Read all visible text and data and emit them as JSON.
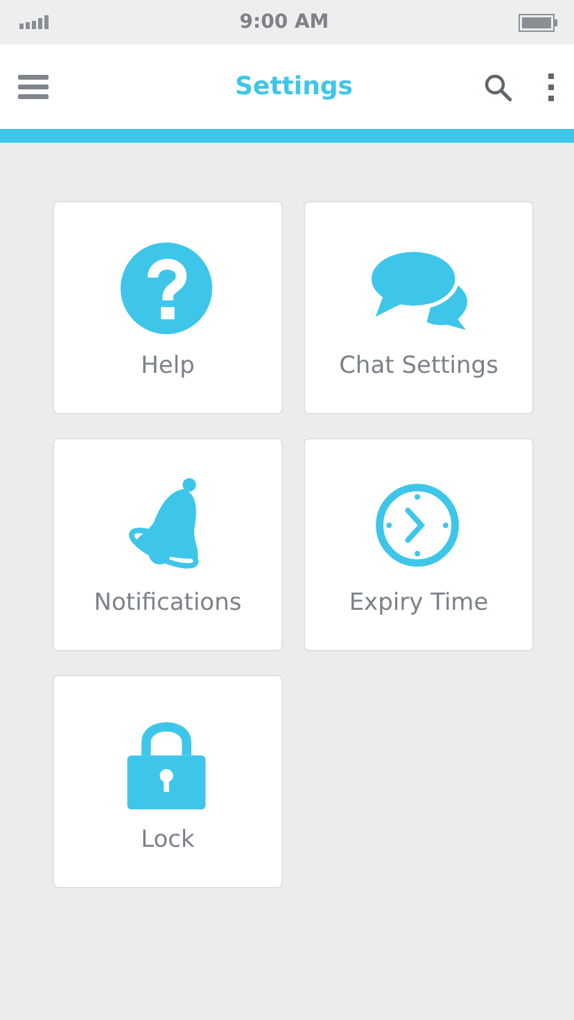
{
  "status_bar": {
    "time": "9:00 AM"
  },
  "app_bar": {
    "title": "Settings"
  },
  "tiles": [
    {
      "kind": "help",
      "label": "Help"
    },
    {
      "kind": "chat",
      "label": "Chat Settings"
    },
    {
      "kind": "bell",
      "label": "Notifications"
    },
    {
      "kind": "clock",
      "label": "Expiry Time"
    },
    {
      "kind": "lock",
      "label": "Lock"
    }
  ]
}
